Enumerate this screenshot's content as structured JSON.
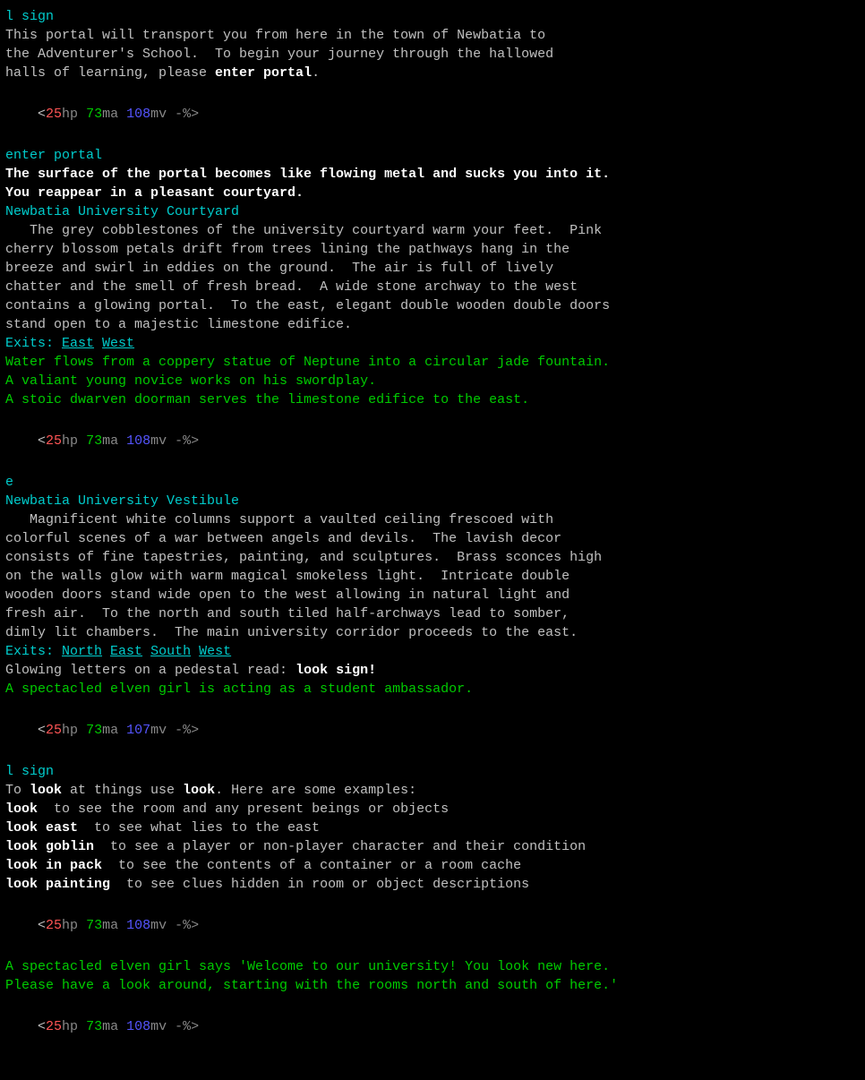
{
  "terminal": {
    "blocks": [
      {
        "id": "block1",
        "lines": [
          {
            "type": "cmd",
            "text": "l sign"
          },
          {
            "type": "normal",
            "text": "This portal will transport you from here in the town of Newbatia to"
          },
          {
            "type": "normal",
            "text": "the Adventurer's School.  To begin your journey through the hallowed"
          },
          {
            "type": "normal",
            "parts": [
              {
                "t": "normal",
                "v": "halls of learning, please "
              },
              {
                "t": "bold-white",
                "v": "enter portal"
              },
              {
                "t": "normal",
                "v": "."
              }
            ]
          }
        ]
      },
      {
        "id": "prompt1",
        "type": "prompt",
        "hp": "25",
        "ma": "73",
        "mv": "108"
      },
      {
        "id": "block2",
        "lines": [
          {
            "type": "cmd",
            "text": "enter portal"
          },
          {
            "type": "bold-white",
            "text": "The surface of the portal becomes like flowing metal and sucks you into it."
          },
          {
            "type": "bold-white",
            "text": "You reappear in a pleasant courtyard."
          },
          {
            "type": "room-name",
            "text": "Newbatia University Courtyard"
          },
          {
            "type": "normal",
            "text": "   The grey cobblestones of the university courtyard warm your feet.  Pink"
          },
          {
            "type": "normal",
            "text": "cherry blossom petals drift from trees lining the pathways hang in the"
          },
          {
            "type": "normal",
            "text": "breeze and swirl in eddies on the ground.  The air is full of lively"
          },
          {
            "type": "normal",
            "text": "chatter and the smell of fresh bread.  A wide stone archway to the west"
          },
          {
            "type": "normal",
            "text": "contains a glowing portal.  To the east, elegant double wooden double doors"
          },
          {
            "type": "normal",
            "text": "stand open to a majestic limestone edifice."
          },
          {
            "type": "exits",
            "text": "Exits: ",
            "exits": [
              "East",
              "West"
            ]
          },
          {
            "type": "green-italic",
            "text": "Water flows from a coppery statue of Neptune into a circular jade fountain."
          },
          {
            "type": "green-italic",
            "text": "A valiant young novice works on his swordplay."
          },
          {
            "type": "green-italic",
            "text": "A stoic dwarven doorman serves the limestone edifice to the east."
          }
        ]
      },
      {
        "id": "prompt2",
        "type": "prompt",
        "hp": "25",
        "ma": "73",
        "mv": "108"
      },
      {
        "id": "block3",
        "lines": [
          {
            "type": "cmd",
            "text": "e"
          },
          {
            "type": "room-name",
            "text": "Newbatia University Vestibule"
          },
          {
            "type": "normal",
            "text": "   Magnificent white columns support a vaulted ceiling frescoed with"
          },
          {
            "type": "normal",
            "text": "colorful scenes of a war between angels and devils.  The lavish decor"
          },
          {
            "type": "normal-orange-mix",
            "text": "consists of fine tapestries, painting, and sculptures.  Brass sconces high"
          },
          {
            "type": "normal-orange-mix2",
            "text": "on the walls glow with warm magical smokeless light.  Intricate double"
          },
          {
            "type": "normal",
            "text": "wooden doors stand wide open to the west allowing in natural light and"
          },
          {
            "type": "normal",
            "text": "fresh air.  To the north and south tiled half-archways lead to somber,"
          },
          {
            "type": "normal",
            "text": "dimly lit chambers.  The main university corridor proceeds to the east."
          },
          {
            "type": "exits4",
            "text": "Exits: ",
            "exits": [
              "North",
              "East",
              "South",
              "West"
            ]
          },
          {
            "type": "sign-line",
            "parts": [
              {
                "t": "normal",
                "v": "Glowing letters on a pedestal read: "
              },
              {
                "t": "bold-white-bright",
                "v": "look sign!"
              }
            ]
          },
          {
            "type": "green-italic",
            "text": "A spectacled elven girl is acting as a student ambassador."
          }
        ]
      },
      {
        "id": "prompt3",
        "type": "prompt",
        "hp": "25",
        "ma": "73",
        "mv": "107"
      },
      {
        "id": "block4",
        "lines": [
          {
            "type": "cmd",
            "text": "l sign"
          },
          {
            "type": "look-help",
            "parts": [
              {
                "t": "normal",
                "v": "To "
              },
              {
                "t": "bold-white",
                "v": "look"
              },
              {
                "t": "normal",
                "v": " at things use "
              },
              {
                "t": "bold-white",
                "v": "look"
              },
              {
                "t": "normal",
                "v": ". Here are some examples:"
              }
            ]
          },
          {
            "type": "look-example",
            "parts": [
              {
                "t": "bold-white",
                "v": "look"
              },
              {
                "t": "normal",
                "v": "  to see the room and any present beings or objects"
              }
            ]
          },
          {
            "type": "look-example",
            "parts": [
              {
                "t": "bold-white",
                "v": "look east"
              },
              {
                "t": "normal",
                "v": "  to see what lies to the east"
              }
            ]
          },
          {
            "type": "look-example",
            "parts": [
              {
                "t": "bold-white",
                "v": "look goblin"
              },
              {
                "t": "normal",
                "v": "  to see a player or non-player character and their condition"
              }
            ]
          },
          {
            "type": "look-example",
            "parts": [
              {
                "t": "bold-white",
                "v": "look in pack"
              },
              {
                "t": "normal",
                "v": "  to see the contents of a container or a room cache"
              }
            ]
          },
          {
            "type": "look-example",
            "parts": [
              {
                "t": "bold-white",
                "v": "look painting"
              },
              {
                "t": "normal",
                "v": "  to see clues hidden in room or object descriptions"
              }
            ]
          }
        ]
      },
      {
        "id": "prompt4",
        "type": "prompt",
        "hp": "25",
        "ma": "73",
        "mv": "108"
      },
      {
        "id": "block5",
        "lines": [
          {
            "type": "green-italic",
            "text": "A spectacled elven girl says 'Welcome to our university! You look new here."
          },
          {
            "type": "green-italic",
            "text": "Please have a look around, starting with the rooms north and south of here.'"
          }
        ]
      },
      {
        "id": "prompt5",
        "type": "prompt",
        "hp": "25",
        "ma": "73",
        "mv": "108"
      }
    ]
  }
}
